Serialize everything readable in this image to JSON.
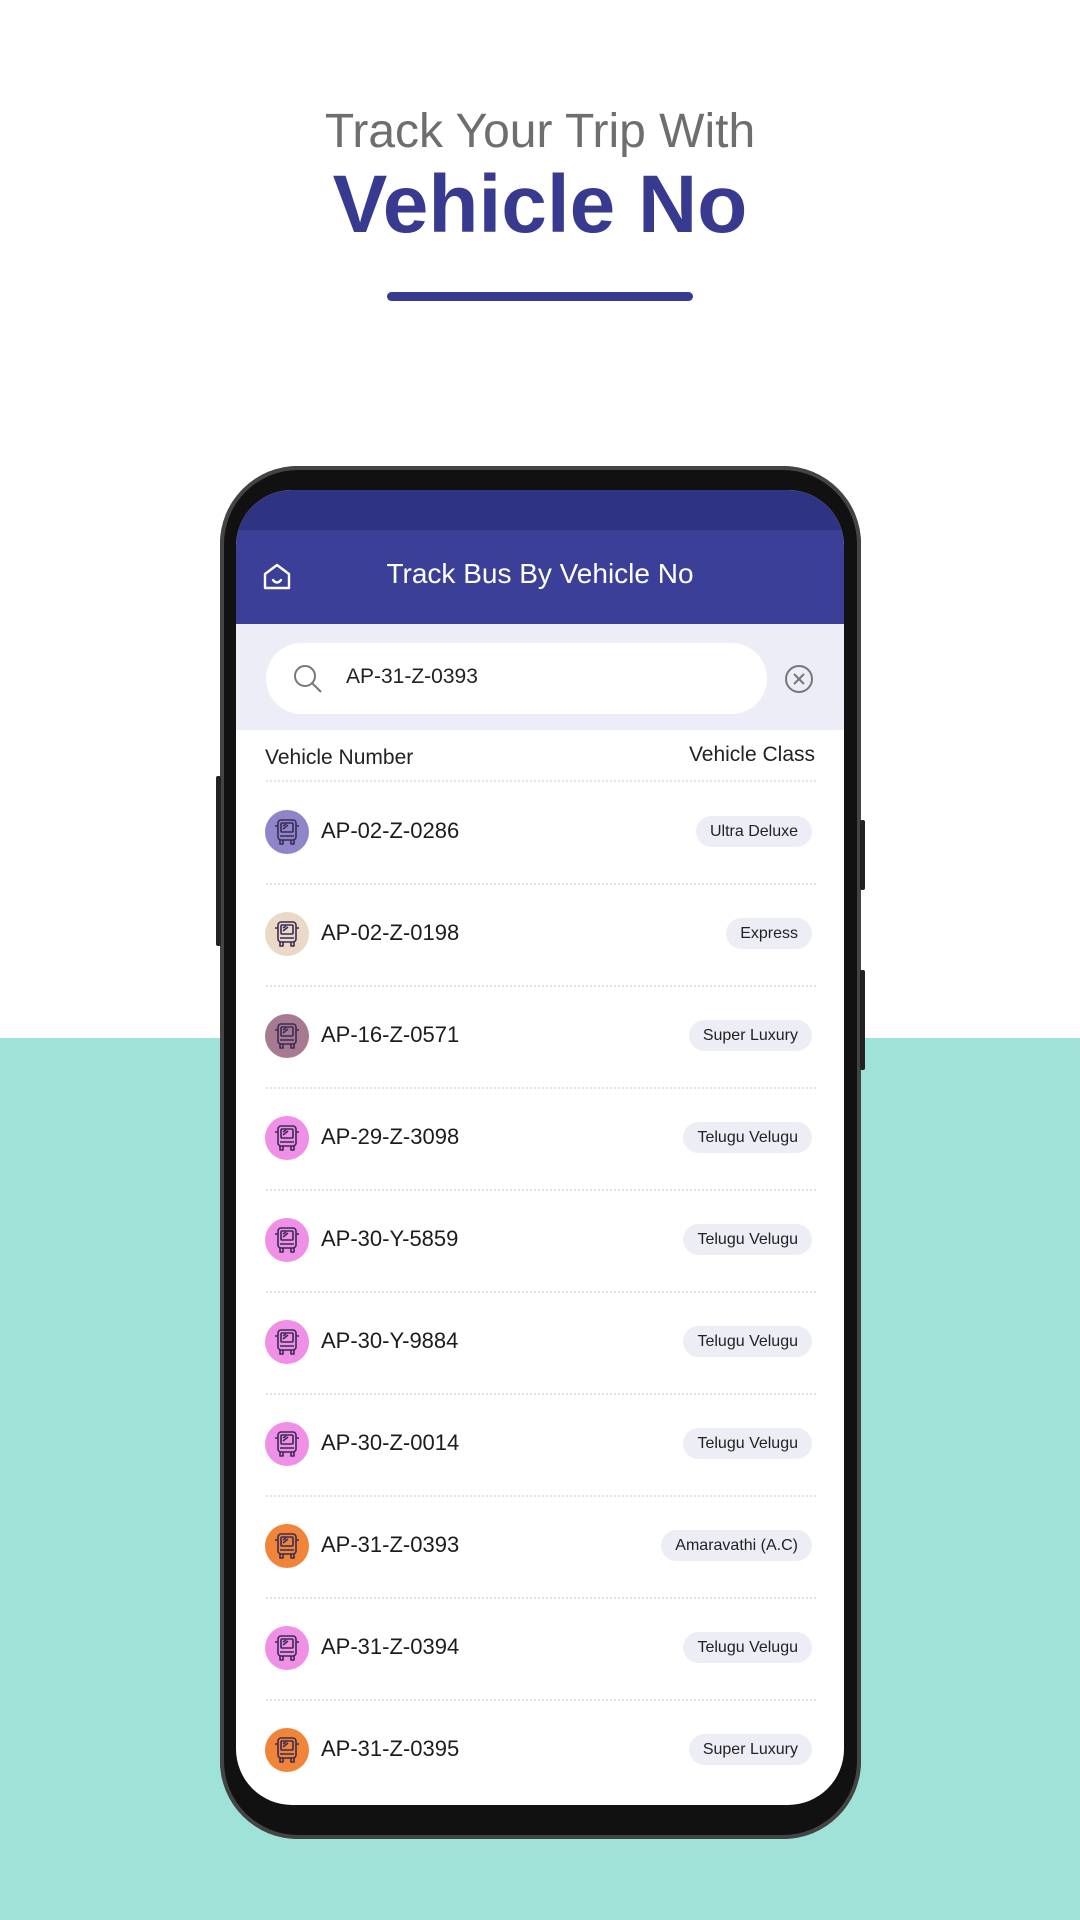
{
  "hero": {
    "line1": "Track Your Trip With",
    "line2": "Vehicle No"
  },
  "colors": {
    "brand": "#373a8e",
    "appbar": "#3c3f97",
    "teal": "#9fe3d8"
  },
  "appbar": {
    "title": "Track Bus By Vehicle No",
    "home_icon": "home-icon"
  },
  "search": {
    "value": "AP-31-Z-0393",
    "search_icon": "search-icon",
    "clear_icon": "close-circle-icon"
  },
  "columns": {
    "number": "Vehicle Number",
    "class": "Vehicle Class"
  },
  "vehicles": [
    {
      "number": "AP-02-Z-0286",
      "class": "Ultra Deluxe",
      "color": "#8f86c9"
    },
    {
      "number": "AP-02-Z-0198",
      "class": "Express",
      "color": "#ead9c6"
    },
    {
      "number": "AP-16-Z-0571",
      "class": "Super Luxury",
      "color": "#a87a92"
    },
    {
      "number": "AP-29-Z-3098",
      "class": "Telugu Velugu",
      "color": "#ef90e6"
    },
    {
      "number": "AP-30-Y-5859",
      "class": "Telugu Velugu",
      "color": "#ef90e6"
    },
    {
      "number": "AP-30-Y-9884",
      "class": "Telugu Velugu",
      "color": "#ef90e6"
    },
    {
      "number": "AP-30-Z-0014",
      "class": "Telugu Velugu",
      "color": "#ef90e6"
    },
    {
      "number": "AP-31-Z-0393",
      "class": "Amaravathi (A.C)",
      "color": "#f0853a"
    },
    {
      "number": "AP-31-Z-0394",
      "class": "Telugu Velugu",
      "color": "#ef90e6"
    },
    {
      "number": "AP-31-Z-0395",
      "class": "Super Luxury",
      "color": "#f0853a"
    }
  ]
}
